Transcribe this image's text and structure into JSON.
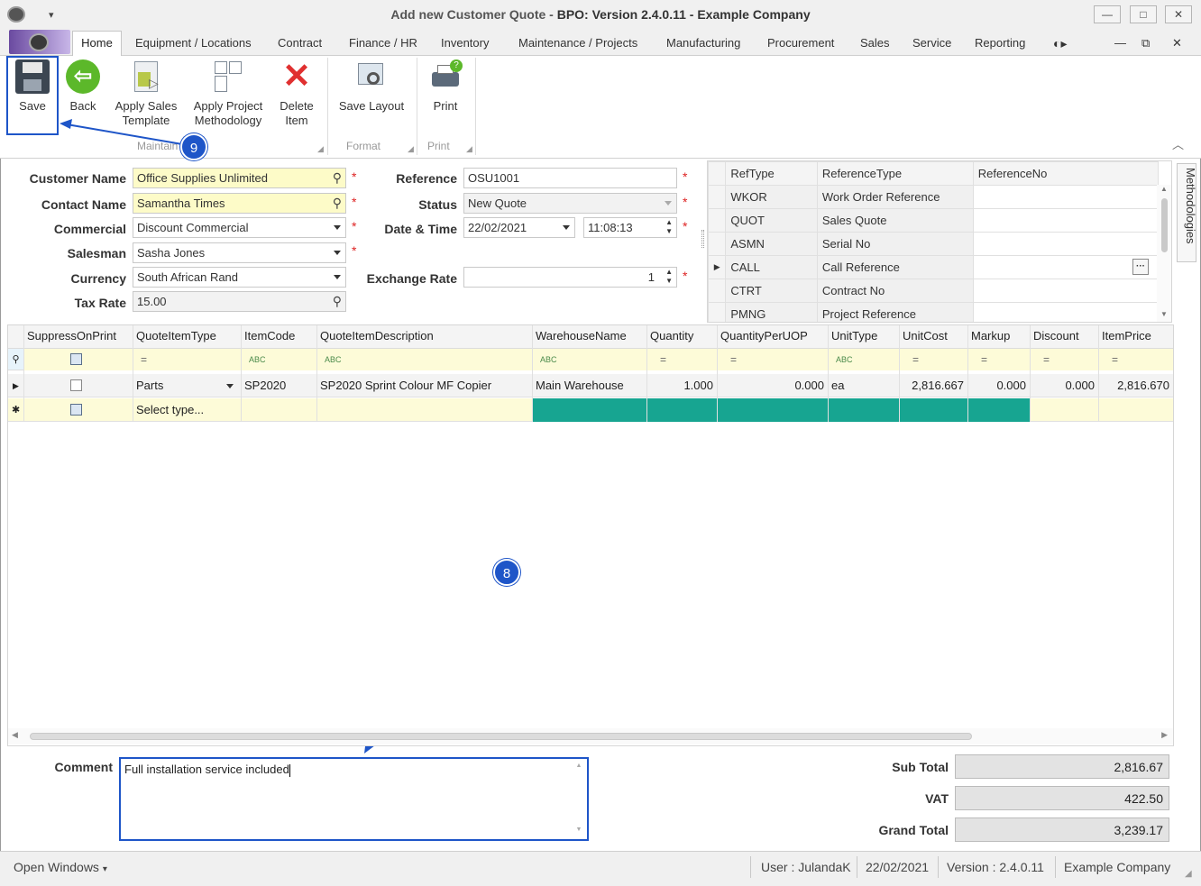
{
  "window": {
    "title_prefix": "Add new Customer Quote - ",
    "title_bold": "BPO: Version 2.4.0.11 - Example Company",
    "minimize_icon": "minimize-icon",
    "maximize_icon": "maximize-icon",
    "close_icon": "close-icon"
  },
  "menu": {
    "tabs": [
      "Home",
      "Equipment / Locations",
      "Contract",
      "Finance / HR",
      "Inventory",
      "Maintenance / Projects",
      "Manufacturing",
      "Procurement",
      "Sales",
      "Service",
      "Reporting"
    ]
  },
  "ribbon": {
    "save": "Save",
    "back": "Back",
    "apply_sales_1": "Apply Sales",
    "apply_sales_2": "Template",
    "apply_project_1": "Apply Project",
    "apply_project_2": "Methodology",
    "delete_1": "Delete",
    "delete_2": "Item",
    "save_layout": "Save Layout",
    "print": "Print",
    "group_maintain": "Maintain",
    "group_format": "Format",
    "group_print": "Print"
  },
  "form": {
    "customer_name_label": "Customer Name",
    "customer_name": "Office Supplies Unlimited",
    "contact_name_label": "Contact Name",
    "contact_name": "Samantha Times",
    "commercial_label": "Commercial",
    "commercial": "Discount Commercial",
    "salesman_label": "Salesman",
    "salesman": "Sasha Jones",
    "currency_label": "Currency",
    "currency": "South African Rand",
    "tax_rate_label": "Tax Rate",
    "tax_rate": "15.00",
    "reference_label": "Reference",
    "reference": "OSU1001",
    "status_label": "Status",
    "status": "New Quote",
    "datetime_label": "Date & Time",
    "date": "22/02/2021",
    "time": "11:08:13",
    "exchange_rate_label": "Exchange Rate",
    "exchange_rate": "1",
    "required_mark": "*"
  },
  "ref_grid": {
    "headers": [
      "RefType",
      "ReferenceType",
      "ReferenceNo"
    ],
    "rows": [
      [
        "WKOR",
        "Work Order Reference",
        ""
      ],
      [
        "QUOT",
        "Sales Quote",
        ""
      ],
      [
        "ASMN",
        "Serial No",
        ""
      ],
      [
        "CALL",
        "Call Reference",
        ""
      ],
      [
        "CTRT",
        "Contract No",
        ""
      ],
      [
        "PMNG",
        "Project Reference",
        ""
      ]
    ],
    "side_tab": "Methodologies",
    "ellipsis": "···"
  },
  "items_grid": {
    "headers": [
      "SuppressOnPrint",
      "QuoteItemType",
      "ItemCode",
      "QuoteItemDescription",
      "WarehouseName",
      "Quantity",
      "QuantityPerUOP",
      "UnitType",
      "UnitCost",
      "Markup",
      "Discount",
      "ItemPrice"
    ],
    "row": {
      "type": "Parts",
      "code": "SP2020",
      "description": "SP2020 Sprint Colour MF Copier",
      "warehouse": "Main Warehouse",
      "quantity": "1.000",
      "qty_per_uop": "0.000",
      "unit_type": "ea",
      "unit_cost": "2,816.667",
      "markup": "0.000",
      "discount": "0.000",
      "item_price": "2,816.670"
    },
    "new_row_placeholder": "Select type...",
    "filter_text": "ABC",
    "filter_eq": "="
  },
  "comment": {
    "label": "Comment",
    "value": "Full installation service included"
  },
  "totals": {
    "sub_total_label": "Sub Total",
    "sub_total": "2,816.67",
    "vat_label": "VAT",
    "vat": "422.50",
    "grand_total_label": "Grand Total",
    "grand_total": "3,239.17"
  },
  "annotations": {
    "badge_save": "9",
    "badge_comment": "8",
    "accent": "#1e55c8"
  },
  "status_bar": {
    "open_windows": "Open Windows",
    "user": "User : JulandaK",
    "date": "22/02/2021",
    "version": "Version : 2.4.0.11",
    "company": "Example Company"
  }
}
